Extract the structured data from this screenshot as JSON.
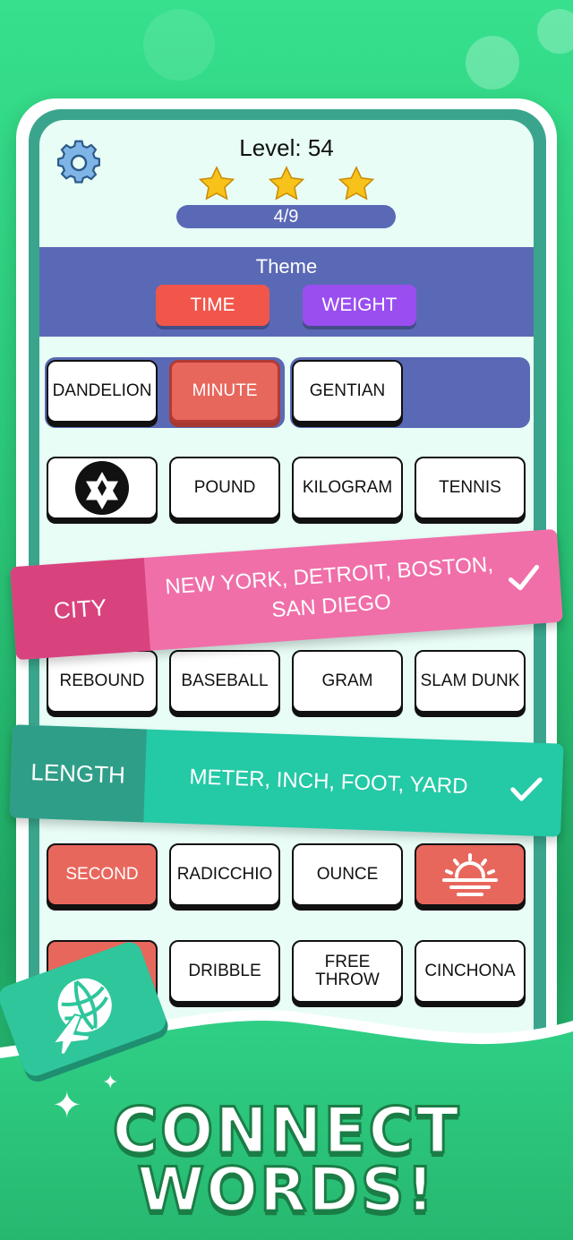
{
  "header": {
    "level_text": "Level: 54",
    "stars_earned": 3,
    "stars_total": 3,
    "progress_text": "4/9"
  },
  "theme": {
    "title": "Theme",
    "categories": [
      {
        "label": "TIME",
        "color": "#f2554a"
      },
      {
        "label": "WEIGHT",
        "color": "#9a4ef0"
      }
    ]
  },
  "board": {
    "row1": [
      "DANDELION",
      "MINUTE",
      "GENTIAN"
    ],
    "row2": [
      "soccer-ball-icon",
      "POUND",
      "KILOGRAM",
      "TENNIS"
    ],
    "row3": [
      "REBOUND",
      "BASEBALL",
      "GRAM",
      "SLAM DUNK"
    ],
    "row4": [
      "SECOND",
      "RADICCHIO",
      "OUNCE",
      "sunrise-icon"
    ],
    "row5": [
      "",
      "DRIBBLE",
      "FREE THROW",
      "CINCHONA"
    ]
  },
  "solved": [
    {
      "category": "CITY",
      "words": "NEW YORK, DETROIT, BOSTON, SAN DIEGO",
      "label_color": "#d8437e",
      "words_color": "#f06fa9"
    },
    {
      "category": "LENGTH",
      "words": "METER, INCH, FOOT, YARD",
      "label_color": "#2f9e88",
      "words_color": "#24c9a6"
    }
  ],
  "promo": {
    "line1": "CONNECT",
    "line2": "WORDS!"
  },
  "colors": {
    "board_bg": "#e8fdf6",
    "band_blue": "#5a69b5",
    "tile_red": "#e8675c",
    "bg_green": "#2bc778"
  }
}
